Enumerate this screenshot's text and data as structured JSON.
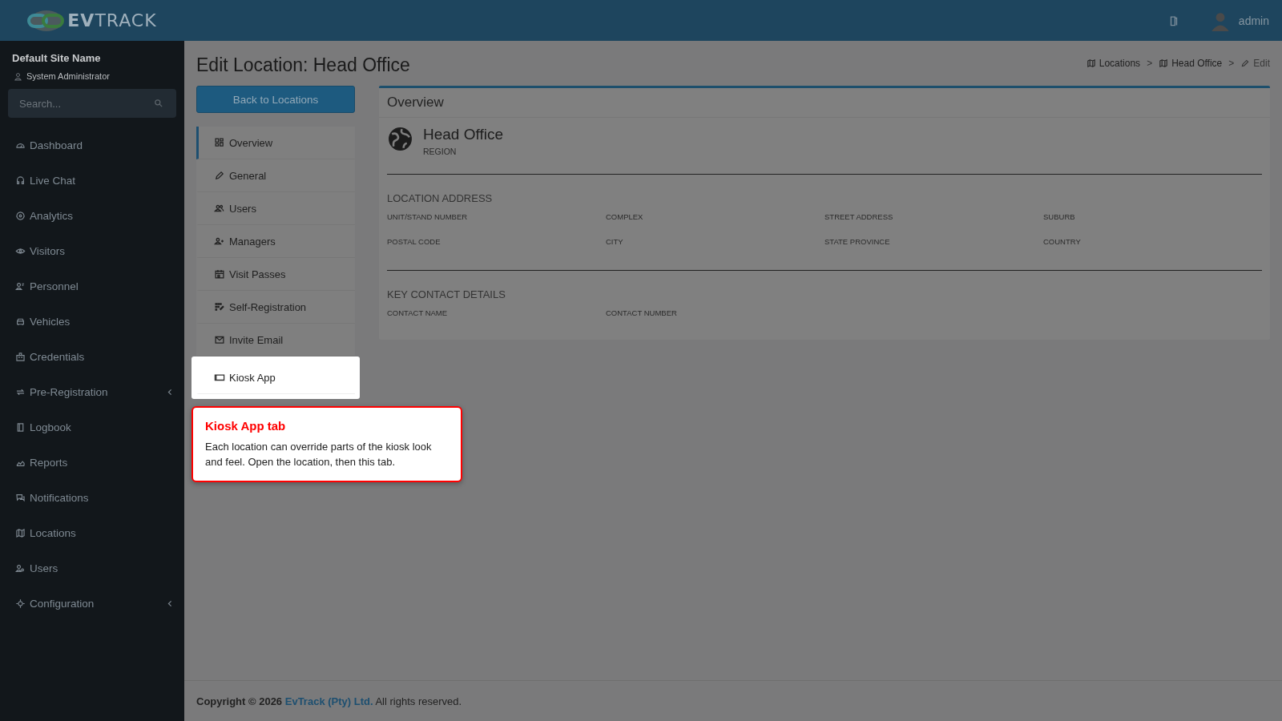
{
  "header": {
    "brand": "**EV**TRACK",
    "user": "admin"
  },
  "sidebar": {
    "site_name": "Default Site Name",
    "role": "System Administrator",
    "search": {
      "placeholder": "Search..."
    },
    "items": [
      {
        "label": "Dashboard",
        "expandable": false
      },
      {
        "label": "Live Chat",
        "expandable": false
      },
      {
        "label": "Analytics",
        "expandable": false
      },
      {
        "label": "Visitors",
        "expandable": false
      },
      {
        "label": "Personnel",
        "expandable": false
      },
      {
        "label": "Vehicles",
        "expandable": false
      },
      {
        "label": "Credentials",
        "expandable": false
      },
      {
        "label": "Pre-Registration",
        "expandable": true
      },
      {
        "label": "Logbook",
        "expandable": false
      },
      {
        "label": "Reports",
        "expandable": false
      },
      {
        "label": "Notifications",
        "expandable": false
      },
      {
        "label": "Locations",
        "expandable": false
      },
      {
        "label": "Users",
        "expandable": false
      },
      {
        "label": "Configuration",
        "expandable": true
      }
    ]
  },
  "page": {
    "title": "Edit Location: Head Office",
    "breadcrumb": [
      "Locations",
      "Head Office",
      "Edit"
    ],
    "breadcrumb_separator": ">",
    "back_button": "Back to Locations"
  },
  "tabs": [
    {
      "label": "Overview",
      "selected": true,
      "highlighted": false
    },
    {
      "label": "General",
      "selected": false,
      "highlighted": false
    },
    {
      "label": "Users",
      "selected": false,
      "highlighted": false
    },
    {
      "label": "Managers",
      "selected": false,
      "highlighted": false
    },
    {
      "label": "Visit Passes",
      "selected": false,
      "highlighted": false
    },
    {
      "label": "Self-Registration",
      "selected": false,
      "highlighted": false
    },
    {
      "label": "Invite Email",
      "selected": false,
      "highlighted": false
    },
    {
      "label": "Kiosk App",
      "selected": false,
      "highlighted": true
    }
  ],
  "overview": {
    "heading": "Overview",
    "name": "Head Office",
    "type": "REGION",
    "sections": [
      {
        "title": "LOCATION ADDRESS",
        "fields": [
          "UNIT/STAND NUMBER",
          "COMPLEX",
          "STREET ADDRESS",
          "SUBURB",
          "POSTAL CODE",
          "CITY",
          "STATE PROVINCE",
          "COUNTRY"
        ]
      },
      {
        "title": "KEY CONTACT DETAILS",
        "fields": [
          "CONTACT NAME",
          "CONTACT NUMBER"
        ]
      }
    ]
  },
  "callout": {
    "title": "Kiosk App tab",
    "text": "Each location can override parts of the kiosk look and feel. Open the location, then this tab."
  },
  "footer": {
    "copyright": "Copyright © 2026",
    "company": "EvTrack (Pty) Ltd.",
    "rest": "All rights reserved."
  }
}
